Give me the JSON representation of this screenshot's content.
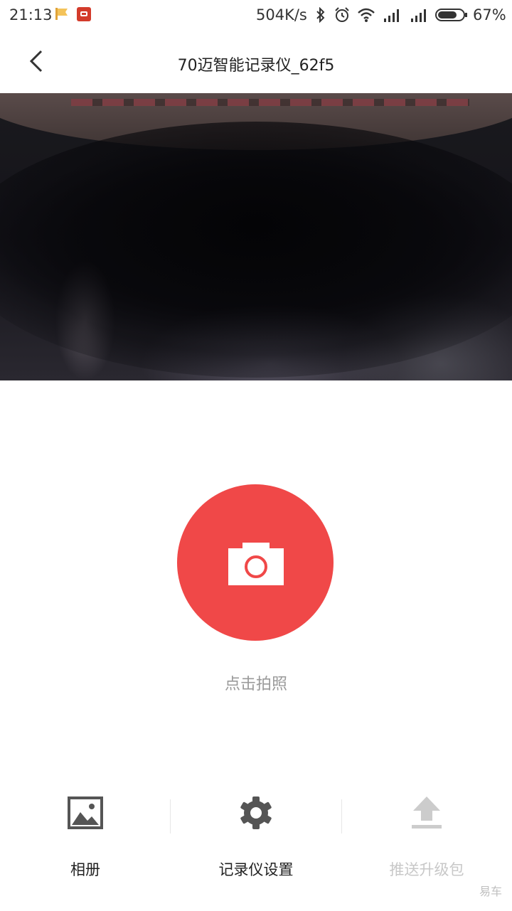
{
  "status_bar": {
    "time": "21:13",
    "net_speed": "504K/s",
    "battery": "67%",
    "icons": [
      "flag-icon",
      "app-notification-icon",
      "bluetooth-icon",
      "alarm-icon",
      "wifi-icon",
      "signal-icon",
      "signal-icon",
      "battery-icon"
    ]
  },
  "header": {
    "title": "70迈智能记录仪_62f5",
    "back_icon": "chevron-left-icon"
  },
  "preview": {
    "fullscreen_icon": "expand-icon"
  },
  "shutter": {
    "label": "点击拍照",
    "icon": "camera-icon",
    "color": "#f04848"
  },
  "actions": [
    {
      "label": "相册",
      "icon": "image-icon",
      "enabled": true
    },
    {
      "label": "记录仪设置",
      "icon": "gear-icon",
      "enabled": true
    },
    {
      "label": "推送升级包",
      "icon": "upload-icon",
      "enabled": false
    }
  ],
  "watermark": "易车"
}
